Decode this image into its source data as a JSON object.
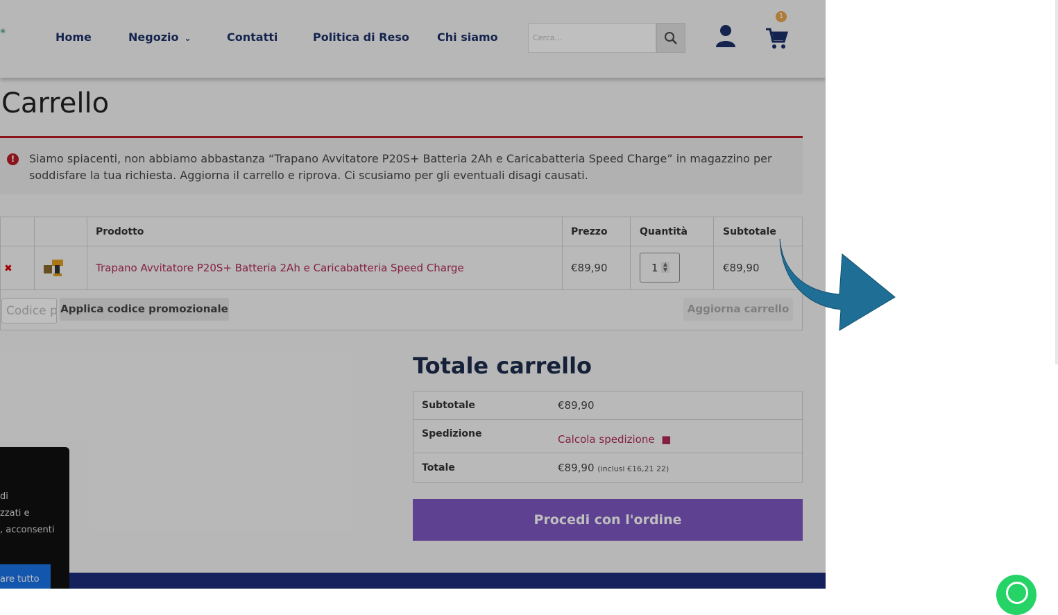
{
  "header": {
    "nav": [
      {
        "label": "Home"
      },
      {
        "label": "Negozio"
      },
      {
        "label": "Contatti"
      },
      {
        "label": "Politica di Reso"
      },
      {
        "label": "Chi siamo"
      }
    ],
    "search_placeholder": "Cerca...",
    "cart_count": "1"
  },
  "page": {
    "title": "Carrello",
    "error_message": "Siamo spiacenti, non abbiamo abbastanza “Trapano Avvitatore P20S+ Batteria 2Ah e Caricabatteria Speed Charge” in magazzino per soddisfare la tua richiesta. Aggiorna il carrello e riprova. Ci scusiamo per gli eventuali disagi causati."
  },
  "cart": {
    "columns": {
      "product": "Prodotto",
      "price": "Prezzo",
      "quantity": "Quantità",
      "subtotal": "Subtotale"
    },
    "items": [
      {
        "name": "Trapano Avvitatore P20S+ Batteria 2Ah e Caricabatteria Speed Charge",
        "price": "€89,90",
        "quantity": "1",
        "subtotal": "€89,90"
      }
    ],
    "coupon_placeholder": "Codice promozionale",
    "apply_label": "Applica codice promozionale",
    "update_label": "Aggiorna carrello"
  },
  "totals": {
    "title": "Totale carrello",
    "subtotal_label": "Subtotale",
    "subtotal_value": "€89,90",
    "shipping_label": "Spedizione",
    "shipping_link": "Calcola spedizione",
    "total_label": "Totale",
    "total_value": "€89,90",
    "total_note": "(inclusi €16,21 22)",
    "checkout_label": "Procedi con l'ordine"
  },
  "cookie": {
    "lines": [
      "di",
      "zzati e",
      ", acconsenti"
    ],
    "button_label": "are tutto"
  },
  "colors": {
    "nav_text": "#1d3168",
    "error_border": "#b81c23",
    "product_link": "#b12a5a",
    "checkout": "#7e57c2",
    "footer": "#1d2d7d",
    "badge": "#e9a54b"
  }
}
